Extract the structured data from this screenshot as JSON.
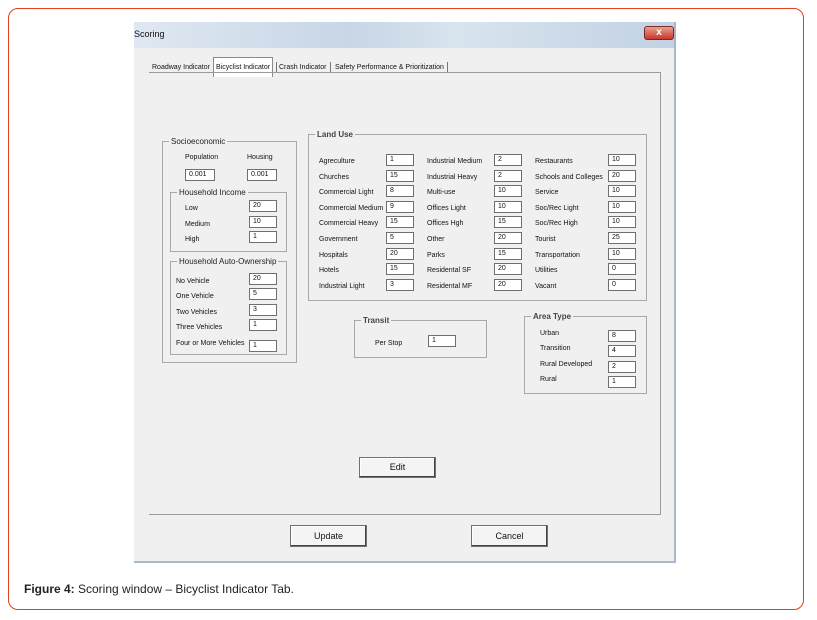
{
  "window": {
    "title": "Scoring",
    "close_label": "x"
  },
  "tabs": [
    "Roadway Indicator",
    "Bicyclist Indicator",
    "Crash Indicator",
    "Safety Performance & Prioritization"
  ],
  "socioeconomic": {
    "legend": "Socioeconomic",
    "population_label": "Population",
    "population_value": "0.001",
    "housing_label": "Housing",
    "housing_value": "0.001"
  },
  "household_income": {
    "legend": "Household Income",
    "rows": [
      {
        "label": "Low",
        "value": "20"
      },
      {
        "label": "Medium",
        "value": "10"
      },
      {
        "label": "High",
        "value": "1"
      }
    ]
  },
  "auto_ownership": {
    "legend": "Household Auto-Ownership",
    "rows": [
      {
        "label": "No Vehicle",
        "value": "20"
      },
      {
        "label": "One Vehicle",
        "value": "5"
      },
      {
        "label": "Two Vehicles",
        "value": "3"
      },
      {
        "label": "Three Vehicles",
        "value": "1"
      },
      {
        "label": "Four or More Vehicles",
        "value": "1"
      }
    ]
  },
  "land_use": {
    "legend": "Land Use",
    "col1": [
      {
        "label": "Agreculture",
        "value": "1"
      },
      {
        "label": "Churches",
        "value": "15"
      },
      {
        "label": "Commercial Light",
        "value": "8"
      },
      {
        "label": "Commercial Medium",
        "value": "9"
      },
      {
        "label": "Commercial Heavy",
        "value": "15"
      },
      {
        "label": "Government",
        "value": "5"
      },
      {
        "label": "Hospitals",
        "value": "20"
      },
      {
        "label": "Hotels",
        "value": "15"
      },
      {
        "label": "Industrial Light",
        "value": "3"
      }
    ],
    "col2": [
      {
        "label": "Industrial Medium",
        "value": "2"
      },
      {
        "label": "Industrial Heavy",
        "value": "2"
      },
      {
        "label": "Multi-use",
        "value": "10"
      },
      {
        "label": "Offices Light",
        "value": "10"
      },
      {
        "label": "Offices Hgh",
        "value": "15"
      },
      {
        "label": "Other",
        "value": "20"
      },
      {
        "label": "Parks",
        "value": "15"
      },
      {
        "label": "Residental SF",
        "value": "20"
      },
      {
        "label": "Residental MF",
        "value": "20"
      }
    ],
    "col3": [
      {
        "label": "Restaurants",
        "value": "10"
      },
      {
        "label": "Schools and Colleges",
        "value": "20"
      },
      {
        "label": "Service",
        "value": "10"
      },
      {
        "label": "Soc/Rec Light",
        "value": "10"
      },
      {
        "label": "Soc/Rec High",
        "value": "10"
      },
      {
        "label": "Tourist",
        "value": "25"
      },
      {
        "label": "Transportation",
        "value": "10"
      },
      {
        "label": "Utilities",
        "value": "0"
      },
      {
        "label": "Vacant",
        "value": "0"
      }
    ]
  },
  "transit": {
    "legend": "Transit",
    "per_stop_label": "Per Stop",
    "per_stop_value": "1"
  },
  "area_type": {
    "legend": "Area Type",
    "rows": [
      {
        "label": "Urban",
        "value": "8"
      },
      {
        "label": "Transition",
        "value": "4"
      },
      {
        "label": "Rural Developed",
        "value": "2"
      },
      {
        "label": "Rural",
        "value": "1"
      }
    ]
  },
  "buttons": {
    "edit": "Edit",
    "update": "Update",
    "cancel": "Cancel"
  },
  "caption": {
    "prefix": "Figure 4:",
    "text": " Scoring window – Bicyclist Indicator Tab."
  }
}
